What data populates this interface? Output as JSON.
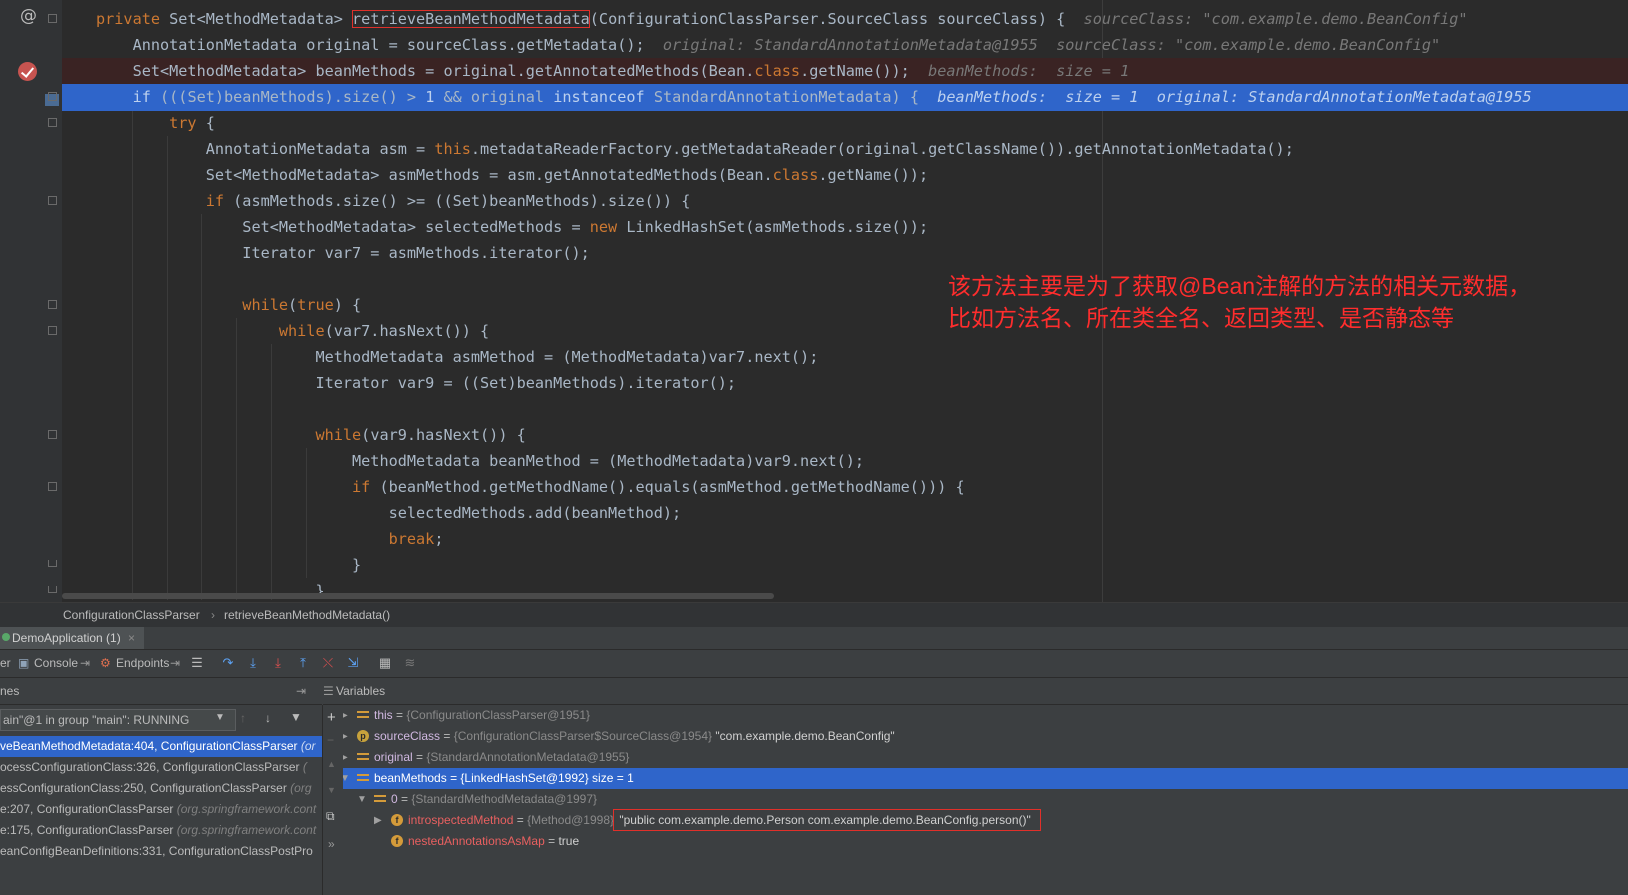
{
  "editor": {
    "lines": [
      {
        "segments": [
          [
            "kw",
            "private "
          ],
          [
            "t",
            "Set<MethodMetadata> "
          ],
          [
            "box",
            "retrieveBeanMethodMetadata"
          ],
          [
            "t",
            "(ConfigurationClassParser.SourceClass sourceClass) {  "
          ],
          [
            "hint",
            "sourceClass: \"com.example.demo.BeanConfig\""
          ]
        ]
      },
      {
        "segments": [
          [
            "t",
            "    AnnotationMetadata original = sourceClass.getMetadata();  "
          ],
          [
            "hint",
            "original: StandardAnnotationMetadata@1955  sourceClass: \"com.example.demo.BeanConfig\""
          ]
        ]
      },
      {
        "segments": [
          [
            "t",
            "    Set<MethodMetadata> beanMethods = original.getAnnotatedMethods(Bean."
          ],
          [
            "kw",
            "class"
          ],
          [
            "t",
            ".getName());  "
          ],
          [
            "hint",
            "beanMethods:  size = 1"
          ]
        ]
      },
      {
        "segments": [
          [
            "kw",
            "    if "
          ],
          [
            "t",
            "(((Set)beanMethods).size() > "
          ],
          [
            "num",
            "1"
          ],
          [
            "t",
            " && original "
          ],
          [
            "kw",
            "instanceof "
          ],
          [
            "t",
            "StandardAnnotationMetadata) {  "
          ],
          [
            "hint",
            "beanMethods:  size = 1  original: StandardAnnotationMetadata@1955"
          ]
        ]
      },
      {
        "segments": [
          [
            "kw",
            "        try "
          ],
          [
            "t",
            "{"
          ]
        ]
      },
      {
        "segments": [
          [
            "t",
            "            AnnotationMetadata asm = "
          ],
          [
            "kw",
            "this"
          ],
          [
            "t",
            ".metadataReaderFactory.getMetadataReader(original.getClassName()).getAnnotationMetadata();"
          ]
        ]
      },
      {
        "segments": [
          [
            "t",
            "            Set<MethodMetadata> asmMethods = asm.getAnnotatedMethods(Bean."
          ],
          [
            "kw",
            "class"
          ],
          [
            "t",
            ".getName());"
          ]
        ]
      },
      {
        "segments": [
          [
            "kw",
            "            if "
          ],
          [
            "t",
            "(asmMethods.size() >= ((Set)beanMethods).size()) {"
          ]
        ]
      },
      {
        "segments": [
          [
            "t",
            "                Set<MethodMetadata> selectedMethods = "
          ],
          [
            "kw",
            "new "
          ],
          [
            "t",
            "LinkedHashSet(asmMethods.size());"
          ]
        ]
      },
      {
        "segments": [
          [
            "t",
            "                Iterator var7 = asmMethods.iterator();"
          ]
        ]
      },
      {
        "segments": [
          [
            "t",
            ""
          ]
        ]
      },
      {
        "segments": [
          [
            "kw",
            "                while"
          ],
          [
            "t",
            "("
          ],
          [
            "kw",
            "true"
          ],
          [
            "t",
            ") {"
          ]
        ]
      },
      {
        "segments": [
          [
            "kw",
            "                    while"
          ],
          [
            "t",
            "(var7.hasNext()) {"
          ]
        ]
      },
      {
        "segments": [
          [
            "t",
            "                        MethodMetadata asmMethod = (MethodMetadata)var7.next();"
          ]
        ]
      },
      {
        "segments": [
          [
            "t",
            "                        Iterator var9 = ((Set)beanMethods).iterator();"
          ]
        ]
      },
      {
        "segments": [
          [
            "t",
            ""
          ]
        ]
      },
      {
        "segments": [
          [
            "kw",
            "                        while"
          ],
          [
            "t",
            "(var9.hasNext()) {"
          ]
        ]
      },
      {
        "segments": [
          [
            "t",
            "                            MethodMetadata beanMethod = (MethodMetadata)var9.next();"
          ]
        ]
      },
      {
        "segments": [
          [
            "kw",
            "                            if "
          ],
          [
            "t",
            "(beanMethod.getMethodName().equals(asmMethod.getMethodName())) {"
          ]
        ]
      },
      {
        "segments": [
          [
            "t",
            "                                selectedMethods.add(beanMethod);"
          ]
        ]
      },
      {
        "segments": [
          [
            "kw",
            "                                break"
          ],
          [
            "t",
            ";"
          ]
        ]
      },
      {
        "segments": [
          [
            "t",
            "                            }"
          ]
        ]
      },
      {
        "segments": [
          [
            "t",
            "                        }"
          ]
        ]
      }
    ],
    "annotation_line1": "该方法主要是为了获取@Bean注解的方法的相关元数据，",
    "annotation_line2": "比如方法名、所在类全名、返回类型、是否静态等"
  },
  "breadcrumb": {
    "class": "ConfigurationClassParser",
    "method": "retrieveBeanMethodMetadata()"
  },
  "run_tab": {
    "label": "DemoApplication (1)",
    "close": "×"
  },
  "toolbar": {
    "left_cut": "er",
    "console": "Console",
    "endpoints": "Endpoints"
  },
  "frames": {
    "header": "nes",
    "thread": "ain\"@1 in group \"main\": RUNNING",
    "items": [
      {
        "text": "veBeanMethodMetadata:404, ConfigurationClassParser ",
        "pkg": "(or",
        "selected": true
      },
      {
        "text": "ocessConfigurationClass:326, ConfigurationClassParser ",
        "pkg": "(",
        "selected": false
      },
      {
        "text": "essConfigurationClass:250, ConfigurationClassParser ",
        "pkg": "(org",
        "selected": false
      },
      {
        "text": "e:207, ConfigurationClassParser ",
        "pkg": "(org.springframework.cont",
        "selected": false
      },
      {
        "text": "e:175, ConfigurationClassParser ",
        "pkg": "(org.springframework.cont",
        "selected": false
      },
      {
        "text": "eanConfigBeanDefinitions:331, ConfigurationClassPostPro",
        "pkg": "",
        "selected": false
      }
    ]
  },
  "variables": {
    "header": "Variables",
    "rows": [
      {
        "indent": 0,
        "toggle": "right",
        "icon": "field",
        "name": "this",
        "type": "{ConfigurationClassParser@1951}",
        "value": "",
        "red": false,
        "selected": false
      },
      {
        "indent": 0,
        "toggle": "right",
        "icon": "param",
        "name": "sourceClass",
        "type": "{ConfigurationClassParser$SourceClass@1954}",
        "value": "\"com.example.demo.BeanConfig\"",
        "red": false,
        "selected": false
      },
      {
        "indent": 0,
        "toggle": "right",
        "icon": "field",
        "name": "original",
        "type": "{StandardAnnotationMetadata@1955}",
        "value": "",
        "red": false,
        "selected": false
      },
      {
        "indent": 0,
        "toggle": "down",
        "icon": "field",
        "name": "beanMethods",
        "type": "{LinkedHashSet@1992}",
        "value": " size = 1",
        "red": false,
        "selected": true
      },
      {
        "indent": 1,
        "toggle": "down",
        "icon": "field",
        "name": "0",
        "type": "{StandardMethodMetadata@1997}",
        "value": "",
        "red": false,
        "selected": false
      },
      {
        "indent": 2,
        "toggle": "right",
        "icon": "fin",
        "name": "introspectedMethod",
        "type": "{Method@1998}",
        "value": "\"public com.example.demo.Person com.example.demo.BeanConfig.person()\"",
        "red": true,
        "selected": false
      },
      {
        "indent": 2,
        "toggle": "",
        "icon": "fin",
        "name": "nestedAnnotationsAsMap",
        "type": "",
        "value": "true",
        "red": true,
        "selected": false
      }
    ]
  },
  "colors": {
    "background": "#2b2b2b",
    "selection": "#2f65ca",
    "keyword": "#cc7832",
    "annotation": "#ff2d2d"
  }
}
